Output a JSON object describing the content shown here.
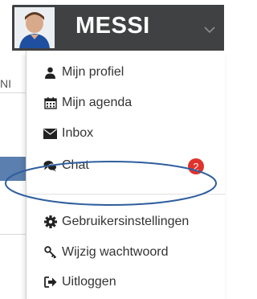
{
  "header": {
    "username": "MESSI",
    "avatar_icon": "user-avatar",
    "caret_icon": "chevron-down-icon"
  },
  "background": {
    "fragment_text": "NI"
  },
  "menu": {
    "items": [
      {
        "label": "Mijn profiel",
        "icon": "user-icon"
      },
      {
        "label": "Mijn agenda",
        "icon": "calendar-icon"
      },
      {
        "label": "Inbox",
        "icon": "envelope-icon"
      },
      {
        "label": "Chat",
        "icon": "chat-icon",
        "badge": "2"
      },
      {
        "label": "Gebruikersinstellingen",
        "icon": "cog-icon"
      },
      {
        "label": "Wijzig wachtwoord",
        "icon": "key-icon"
      },
      {
        "label": "Uitloggen",
        "icon": "sign-out-icon"
      }
    ]
  },
  "colors": {
    "topbar": "#404142",
    "badge": "#e0332c",
    "annotation": "#2f5e9e"
  }
}
